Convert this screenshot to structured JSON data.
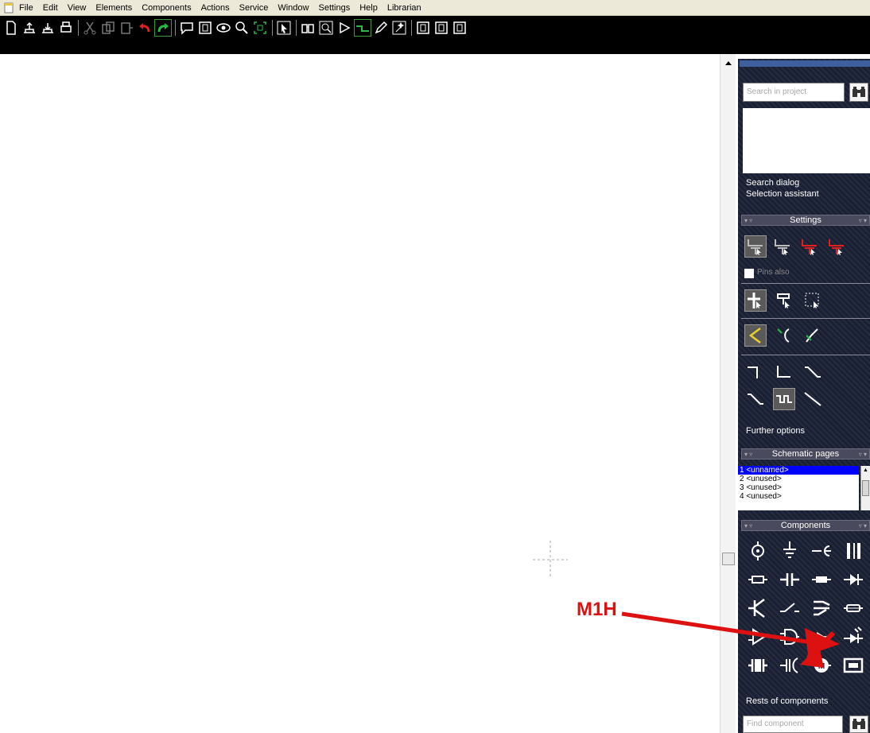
{
  "menubar": {
    "items": [
      "File",
      "Edit",
      "View",
      "Elements",
      "Components",
      "Actions",
      "Service",
      "Window",
      "Settings",
      "Help",
      "Librarian"
    ]
  },
  "panel": {
    "search_placeholder": "Search in project",
    "search_icon": "binoculars-icon",
    "links": {
      "search_dialog": "Search dialog",
      "selection_assistant": "Selection assistant"
    },
    "settings": {
      "header": "Settings",
      "pins_also": "Pins also",
      "further_options": "Further options"
    },
    "schematic_pages": {
      "header": "Schematic pages",
      "pages": [
        "1 <unnamed>",
        "2 <unused>",
        "3 <unused>",
        "4 <unused>"
      ],
      "selected_index": 0
    },
    "components": {
      "header": "Components",
      "icons": [
        "voltage-source-icon",
        "ground-icon",
        "connector-icon",
        "battery-icon",
        "resistor-icon",
        "capacitor-icon",
        "fuse-icon",
        "diode-icon",
        "transistor-icon",
        "switch-icon",
        "relay-switch-icon",
        "inductor-icon",
        "amplifier-icon",
        "logic-gate-icon",
        "optocoupler-icon",
        "photo-diode-icon",
        "crystal-icon",
        "electrolytic-capacitor-icon",
        "motor-icon",
        "display-icon"
      ],
      "rests": "Rests of components",
      "find_placeholder": "Find component"
    }
  },
  "annotation": {
    "label": "M1H",
    "color": "#dd1111"
  },
  "colors": {
    "panel_bg": "#1a2034",
    "toolbar_bg": "#000000",
    "selected_page": "#0000ff"
  }
}
